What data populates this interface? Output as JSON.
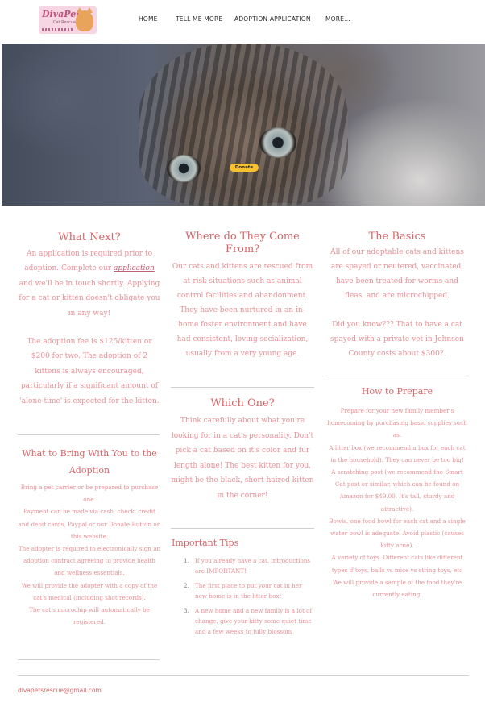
{
  "header": {
    "logo_text": "DivaPets",
    "logo_sub": "Cat Rescue",
    "nav": [
      "HOME",
      "TELL ME MORE",
      "ADOPTION APPLICATION",
      "MORE..."
    ]
  },
  "banner": {
    "donate_label": "Donate"
  },
  "col1": {
    "title": "What Next?",
    "p1_before": "An application is required prior to adoption.  Complete our ",
    "p1_link": "application",
    "p1_after": " and we'll be in touch shortly.  Applying for a cat or kitten doesn't obligate you in any way!",
    "p2": "The adoption fee is $125/kitten or $200 for two. The adoption of 2 kittens is always encouraged, particularly if a significant amount of 'alone time' is expected for the kitten.",
    "title2": "What to Bring With You to the Adoption",
    "bring": [
      "Bring a pet carrier or be prepared to purchase one.",
      "Payment can be made via cash, check, credit and debit cards, Paypal or our Donate Button on this website.",
      "The adopter is required to electronically sign an adoption contract agreeing to provide health and wellness essentials.",
      "We will provide the adopter with a copy of the cat's medical (including shot records).",
      "The cat's microchip will automatically be registered."
    ]
  },
  "col2": {
    "title": "Where do They Come From?",
    "p1": "Our cats and kittens are rescued from at-risk situations such as animal control facilities and abandonment.  They have been nurtured in an in-home foster environment and have had consistent, loving socialization, usually from a very young age.",
    "title2": "Which One?",
    "p2": "Think carefully about what you're looking for in a cat's personality.  Don't pick a cat based on it's color and fur length alone!  The best kitten for you, might be the black, short-haired kitten in the corner!",
    "tips_title": "Important Tips",
    "tips": [
      "If you already have a cat, introductions are IMPORTANT!",
      "The first place to put your cat in her new home is in the litter box!",
      "A new home and a new family is a lot of change, give your kitty some quiet time and a few weeks to fully  blossom"
    ]
  },
  "col3": {
    "title": "The Basics",
    "p1": "All of our adoptable cats and kittens are spayed or neutered, vaccinated, have been treated for worms and fleas, and are microchipped.",
    "p2": "Did you know???  That to have a cat spayed with a private vet in Johnson County costs about $300?.",
    "title2": "How to Prepare",
    "prepare": [
      "Prepare for your new family member's homecoming by purchasing basic supplies such as:",
      "A litter box (we recommend a box for each cat in the household).  They can never be too big!",
      "A scratching post (we recommend the Smart Cat post or similar, which can be found on Amazon for $49.00. It's tall, sturdy and attractive).",
      "Bowls, one food bowl for each cat and a single water bowl is adequate. Avoid plastic (causes kitty acne).",
      "A variety of toys. Different cats like different types if toys, balls vs mice vs string toys, etc",
      "We will provide a sample of the food they're currently eating."
    ]
  },
  "footer": {
    "email": "divapetsrescue@gmail.com"
  }
}
